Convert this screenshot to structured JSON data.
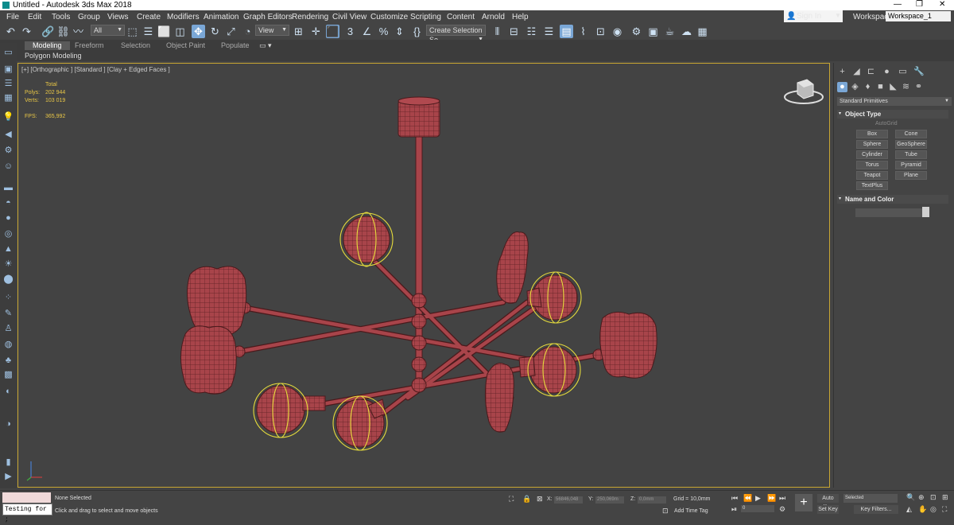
{
  "window": {
    "title": "Untitled - Autodesk 3ds Max 2018",
    "minimize": "—",
    "maximize": "❐",
    "close": "✕"
  },
  "menu": [
    "File",
    "Edit",
    "Tools",
    "Group",
    "Views",
    "Create",
    "Modifiers",
    "Animation",
    "Graph Editors",
    "Rendering",
    "Civil View",
    "Customize",
    "Scripting",
    "Content",
    "Arnold",
    "Help"
  ],
  "signin": {
    "label": "Sign In"
  },
  "workspace": {
    "label": "Workspaces:",
    "value": "Workspace_1"
  },
  "toolbar": {
    "filter_value": "All",
    "view_value": "View",
    "selection_set_placeholder": "Create Selection Se"
  },
  "ribbon": {
    "tabs": [
      "Modeling",
      "Freeform",
      "Selection",
      "Object Paint",
      "Populate"
    ],
    "active_tab": "Modeling",
    "subtitle": "Polygon Modeling"
  },
  "viewport": {
    "label": "[+] [Orthographic ] [Standard ] [Clay + Edged Faces ]",
    "stats": {
      "total_label": "Total",
      "polys_label": "Polys:",
      "polys_value": "202 944",
      "verts_label": "Verts:",
      "verts_value": "103 019",
      "fps_label": "FPS:",
      "fps_value": "365,992"
    },
    "accent_color": "#c8a632",
    "model_color": "#a8444a",
    "selection_color": "#e6dc3c"
  },
  "command_panel": {
    "category": "Standard Primitives",
    "object_type_title": "Object Type",
    "autogrid_label": "AutoGrid",
    "buttons": [
      "Box",
      "Cone",
      "Sphere",
      "GeoSphere",
      "Cylinder",
      "Tube",
      "Torus",
      "Pyramid",
      "Teapot",
      "Plane",
      "TextPlus"
    ],
    "name_color_title": "Name and Color"
  },
  "status": {
    "selection": "None Selected",
    "prompt": "Click and drag to select and move objects",
    "maxscript_value": "Testing for ;",
    "x_label": "X:",
    "x_value": "56846,048",
    "y_label": "Y:",
    "y_value": "250,069m",
    "z_label": "Z:",
    "z_value": "0,0mm",
    "grid": "Grid = 10,0mm",
    "add_time_tag": "Add Time Tag",
    "auto_key": "Auto Key",
    "set_key": "Set Key",
    "key_mode": "Selected",
    "key_filters": "Key Filters...",
    "frame": "0"
  }
}
